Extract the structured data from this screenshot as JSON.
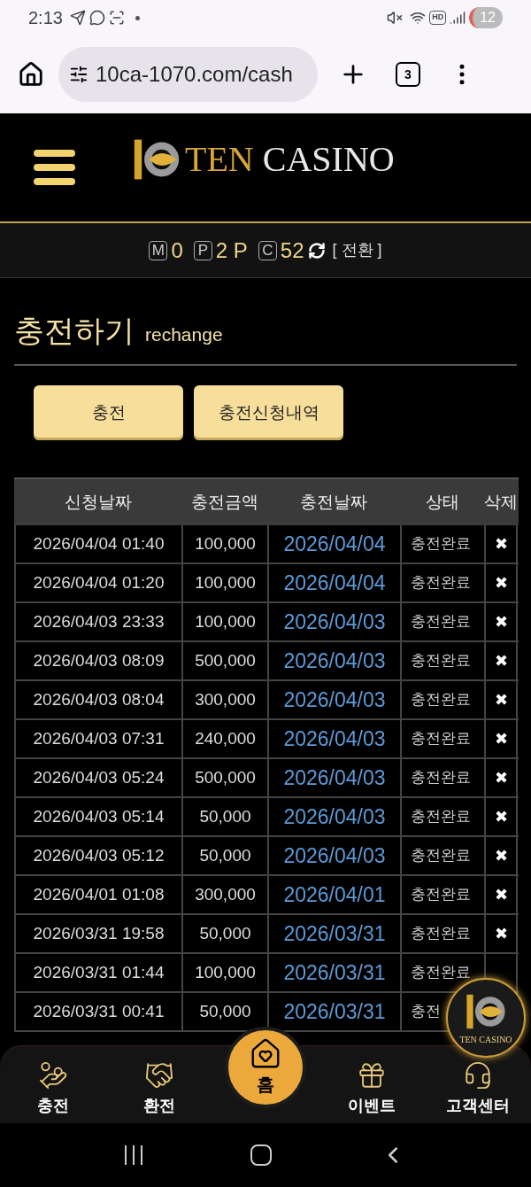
{
  "status_bar": {
    "time": "2:13",
    "battery": "12",
    "hd": "HD"
  },
  "browser": {
    "url": "10ca-1070.com/cash",
    "tab_count": "3"
  },
  "header": {
    "logo_gold": "TEN",
    "logo_white": "CASINO"
  },
  "points": [
    {
      "kind": "M",
      "value": "0"
    },
    {
      "kind": "P",
      "value": "2 P"
    },
    {
      "kind": "C",
      "value": "52"
    }
  ],
  "switch_label": "[ 전환 ]",
  "page_title": {
    "main": "충전하기",
    "sub": "rechange"
  },
  "buttons": [
    "충전",
    "충전신청내역"
  ],
  "table": {
    "columns": [
      "신청날짜",
      "충전금액",
      "충전날짜",
      "상태",
      "삭제"
    ],
    "rows": [
      {
        "requested": "2026/04/04 01:40",
        "amount": "100,000",
        "charged": "2026/04/04",
        "status": "충전완료",
        "delete": "✖"
      },
      {
        "requested": "2026/04/04 01:20",
        "amount": "100,000",
        "charged": "2026/04/04",
        "status": "충전완료",
        "delete": "✖"
      },
      {
        "requested": "2026/04/03 23:33",
        "amount": "100,000",
        "charged": "2026/04/03",
        "status": "충전완료",
        "delete": "✖"
      },
      {
        "requested": "2026/04/03 08:09",
        "amount": "500,000",
        "charged": "2026/04/03",
        "status": "충전완료",
        "delete": "✖"
      },
      {
        "requested": "2026/04/03 08:04",
        "amount": "300,000",
        "charged": "2026/04/03",
        "status": "충전완료",
        "delete": "✖"
      },
      {
        "requested": "2026/04/03 07:31",
        "amount": "240,000",
        "charged": "2026/04/03",
        "status": "충전완료",
        "delete": "✖"
      },
      {
        "requested": "2026/04/03 05:24",
        "amount": "500,000",
        "charged": "2026/04/03",
        "status": "충전완료",
        "delete": "✖"
      },
      {
        "requested": "2026/04/03 05:14",
        "amount": "50,000",
        "charged": "2026/04/03",
        "status": "충전완료",
        "delete": "✖"
      },
      {
        "requested": "2026/04/03 05:12",
        "amount": "50,000",
        "charged": "2026/04/03",
        "status": "충전완료",
        "delete": "✖"
      },
      {
        "requested": "2026/04/01 01:08",
        "amount": "300,000",
        "charged": "2026/04/01",
        "status": "충전완료",
        "delete": "✖"
      },
      {
        "requested": "2026/03/31 19:58",
        "amount": "50,000",
        "charged": "2026/03/31",
        "status": "충전완료",
        "delete": "✖"
      },
      {
        "requested": "2026/03/31 01:44",
        "amount": "100,000",
        "charged": "2026/03/31",
        "status": "충전완료"
      },
      {
        "requested": "2026/03/31 00:41",
        "amount": "50,000",
        "charged": "2026/03/31",
        "status": "충전"
      }
    ]
  },
  "floating_badge": "TEN CASINO",
  "bottom_nav": [
    {
      "kind": "deposit",
      "label": "충전",
      "selected": false
    },
    {
      "kind": "withdraw",
      "label": "환전",
      "selected": false
    },
    {
      "kind": "home",
      "label": "홈",
      "selected": true
    },
    {
      "kind": "event",
      "label": "이벤트",
      "selected": false
    },
    {
      "kind": "support",
      "label": "고객센터",
      "selected": false
    }
  ]
}
